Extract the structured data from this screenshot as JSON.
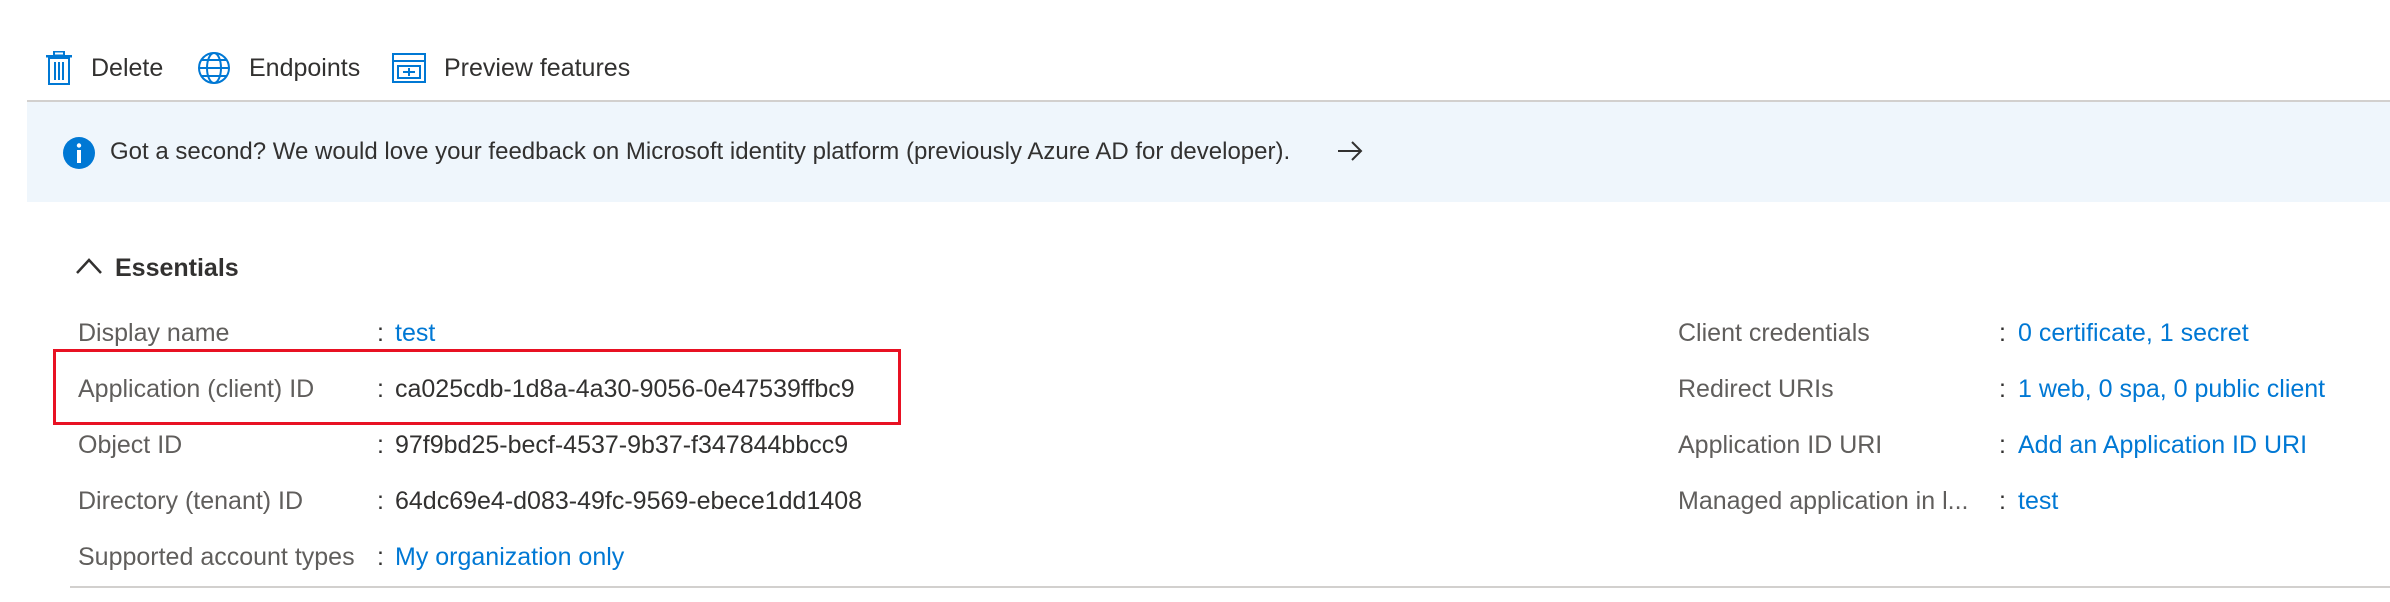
{
  "toolbar": {
    "delete_label": "Delete",
    "endpoints_label": "Endpoints",
    "preview_label": "Preview features"
  },
  "banner": {
    "message": "Got a second? We would love your feedback on Microsoft identity platform (previously Azure AD for developer).",
    "arrow": "→"
  },
  "essentials": {
    "title": "Essentials",
    "separator": ":",
    "left": [
      {
        "label": "Display name",
        "value": "test",
        "link": true
      },
      {
        "label": "Application (client) ID",
        "value": "ca025cdb-1d8a-4a30-9056-0e47539ffbc9",
        "link": false
      },
      {
        "label": "Object ID",
        "value": "97f9bd25-becf-4537-9b37-f347844bbcc9",
        "link": false
      },
      {
        "label": "Directory (tenant) ID",
        "value": "64dc69e4-d083-49fc-9569-ebece1dd1408",
        "link": false
      },
      {
        "label": "Supported account types",
        "value": "My organization only",
        "link": true
      }
    ],
    "right": [
      {
        "label": "Client credentials",
        "value": "0 certificate, 1 secret",
        "link": true
      },
      {
        "label": "Redirect URIs",
        "value": "1 web, 0 spa, 0 public client",
        "link": true
      },
      {
        "label": "Application ID URI",
        "value": "Add an Application ID URI",
        "link": true
      },
      {
        "label": "Managed application in l...",
        "value": "test",
        "link": true
      }
    ]
  },
  "colors": {
    "accent": "#0078d4",
    "banner_bg": "#eff6fc",
    "highlight": "#e81123"
  }
}
